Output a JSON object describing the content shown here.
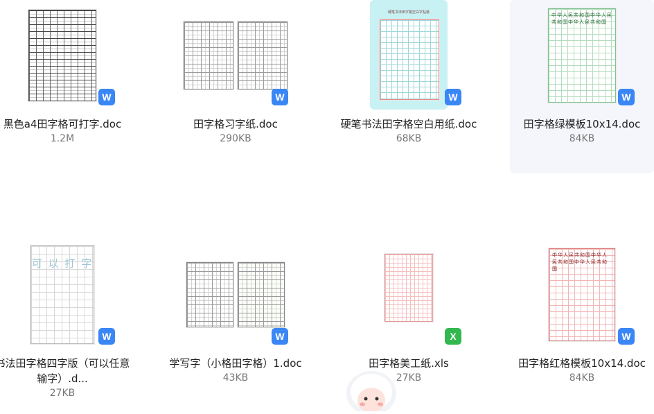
{
  "files": [
    {
      "name": "黑色a4田字格可打字.doc",
      "size": "1.2M",
      "type": "word",
      "badge": "W"
    },
    {
      "name": "田字格习字纸.doc",
      "size": "290KB",
      "type": "word",
      "badge": "W"
    },
    {
      "name": "硬笔书法田字格空白用纸.doc",
      "size": "68KB",
      "type": "word",
      "badge": "W"
    },
    {
      "name": "田字格绿模板10x14.doc",
      "size": "84KB",
      "type": "word",
      "badge": "W"
    },
    {
      "name": "书法田字格四字版（可以任意输字）.d...",
      "size": "27KB",
      "type": "word",
      "badge": "W"
    },
    {
      "name": "学写字（小格田字格）1.doc",
      "size": "43KB",
      "type": "word",
      "badge": "W"
    },
    {
      "name": "田字格美工纸.xls",
      "size": "27KB",
      "type": "excel",
      "badge": "X"
    },
    {
      "name": "田字格红格模板10x14.doc",
      "size": "84KB",
      "type": "word",
      "badge": "W"
    }
  ],
  "thumb_text": {
    "green_sheet": "中华人民共和国中华人民共和国中华人民共和国",
    "red_sheet": "中华人民共和国中华人民共和国中华人民共和国",
    "four_char": "可 以 打 字",
    "cyan_title": "硬笔书法田字格空白字帖纸"
  },
  "colors": {
    "word_badge": "#3a86f5",
    "excel_badge": "#32b84e",
    "selected_bg": "#f4f6fb",
    "cyan_highlight": "#c8f1f3"
  }
}
